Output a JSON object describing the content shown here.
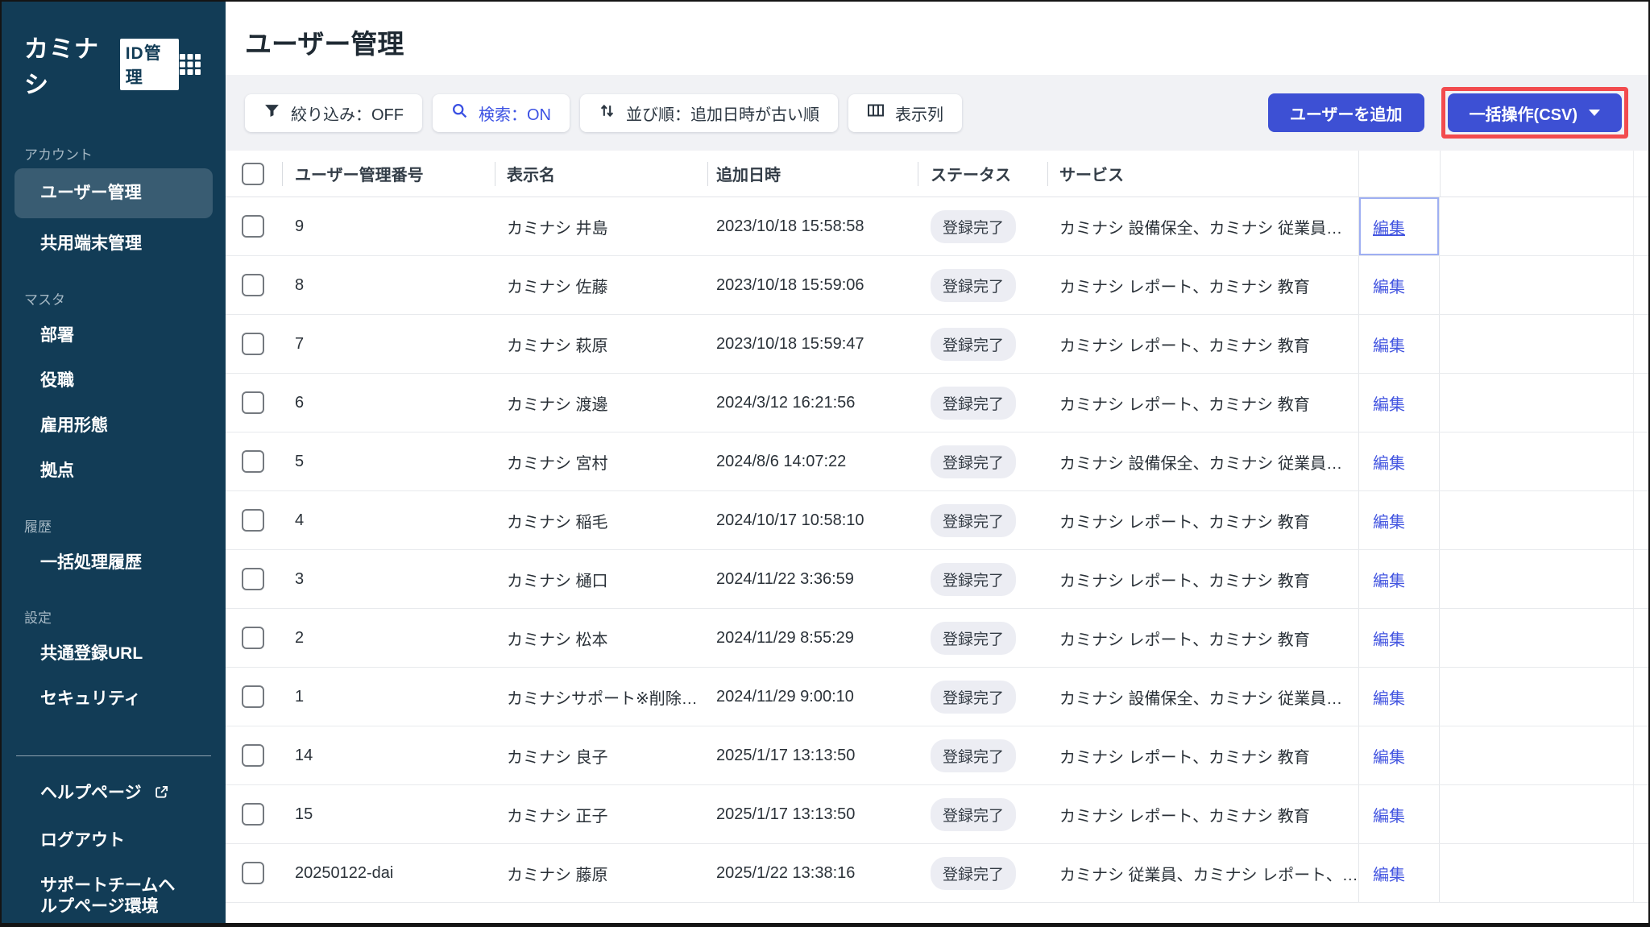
{
  "app": {
    "brand": "カミナシ",
    "badge": "ID管理"
  },
  "colors": {
    "sidebar_bg": "#123C56",
    "accent_blue": "#3D50D4",
    "link_blue": "#4355E0",
    "search_on_blue": "#3B51E3",
    "highlight_red": "#F24B4E",
    "toolbar_band": "#F1F2F5",
    "status_pill_bg": "#ECEDF3"
  },
  "sidebar": {
    "sections": [
      {
        "label": "アカウント",
        "items": [
          {
            "label": "ユーザー管理",
            "active": true
          },
          {
            "label": "共用端末管理"
          }
        ]
      },
      {
        "label": "マスタ",
        "items": [
          {
            "label": "部署"
          },
          {
            "label": "役職"
          },
          {
            "label": "雇用形態"
          },
          {
            "label": "拠点"
          }
        ]
      },
      {
        "label": "履歴",
        "items": [
          {
            "label": "一括処理履歴"
          }
        ]
      },
      {
        "label": "設定",
        "items": [
          {
            "label": "共通登録URL"
          },
          {
            "label": "セキュリティ"
          }
        ]
      }
    ],
    "footer": {
      "help": "ヘルプページ",
      "logout": "ログアウト",
      "support": "サポートチームヘルプページ環境"
    }
  },
  "header": {
    "title": "ユーザー管理"
  },
  "toolbar": {
    "filter_label": "絞り込み：OFF",
    "search_label": "検索：ON",
    "sort_label": "並び順：追加日時が古い順",
    "columns_label": "表示列",
    "add_user_label": "ユーザーを追加",
    "bulk_label": "一括操作(CSV)"
  },
  "table": {
    "headers": [
      "ユーザー管理番号",
      "表示名",
      "追加日時",
      "ステータス",
      "サービス"
    ],
    "edit_label": "編集",
    "rows": [
      {
        "id": "9",
        "name": "カミナシ 井島",
        "added": "2023/10/18 15:58:58",
        "status": "登録完了",
        "services": "カミナシ 設備保全、カミナシ 従業員…",
        "focused": true
      },
      {
        "id": "8",
        "name": "カミナシ 佐藤",
        "added": "2023/10/18 15:59:06",
        "status": "登録完了",
        "services": "カミナシ レポート、カミナシ 教育"
      },
      {
        "id": "7",
        "name": "カミナシ 萩原",
        "added": "2023/10/18 15:59:47",
        "status": "登録完了",
        "services": "カミナシ レポート、カミナシ 教育"
      },
      {
        "id": "6",
        "name": "カミナシ 渡邊",
        "added": "2024/3/12 16:21:56",
        "status": "登録完了",
        "services": "カミナシ レポート、カミナシ 教育"
      },
      {
        "id": "5",
        "name": "カミナシ 宮村",
        "added": "2024/8/6 14:07:22",
        "status": "登録完了",
        "services": "カミナシ 設備保全、カミナシ 従業員…"
      },
      {
        "id": "4",
        "name": "カミナシ 稲毛",
        "added": "2024/10/17 10:58:10",
        "status": "登録完了",
        "services": "カミナシ レポート、カミナシ 教育"
      },
      {
        "id": "3",
        "name": "カミナシ 樋口",
        "added": "2024/11/22 3:36:59",
        "status": "登録完了",
        "services": "カミナシ レポート、カミナシ 教育"
      },
      {
        "id": "2",
        "name": "カミナシ 松本",
        "added": "2024/11/29 8:55:29",
        "status": "登録完了",
        "services": "カミナシ レポート、カミナシ 教育"
      },
      {
        "id": "1",
        "name": "カミナシサポート※削除…",
        "added": "2024/11/29 9:00:10",
        "status": "登録完了",
        "services": "カミナシ 設備保全、カミナシ 従業員…"
      },
      {
        "id": "14",
        "name": "カミナシ 良子",
        "added": "2025/1/17 13:13:50",
        "status": "登録完了",
        "services": "カミナシ レポート、カミナシ 教育"
      },
      {
        "id": "15",
        "name": "カミナシ 正子",
        "added": "2025/1/17 13:13:50",
        "status": "登録完了",
        "services": "カミナシ レポート、カミナシ 教育"
      },
      {
        "id": "20250122-dai",
        "name": "カミナシ 藤原",
        "added": "2025/1/22 13:38:16",
        "status": "登録完了",
        "services": "カミナシ 従業員、カミナシ レポート、…"
      }
    ]
  }
}
